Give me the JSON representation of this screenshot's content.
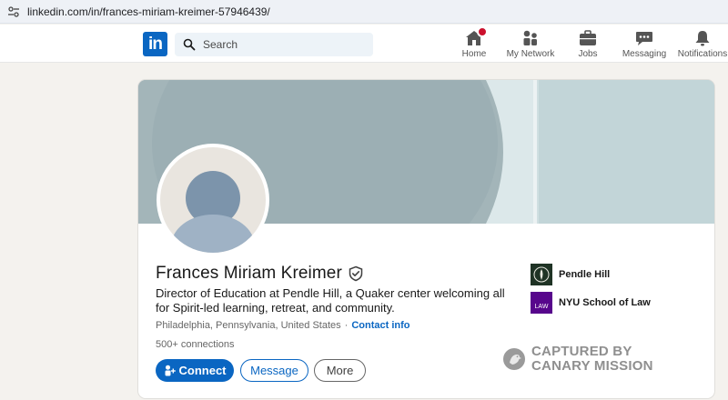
{
  "browser": {
    "url": "linkedin.com/in/frances-miriam-kreimer-57946439/"
  },
  "nav": {
    "search_placeholder": "Search",
    "items": [
      {
        "label": "Home",
        "icon": "home-icon",
        "badge": true
      },
      {
        "label": "My Network",
        "icon": "network-icon"
      },
      {
        "label": "Jobs",
        "icon": "briefcase-icon"
      },
      {
        "label": "Messaging",
        "icon": "messaging-icon"
      },
      {
        "label": "Notifications",
        "icon": "bell-icon"
      }
    ]
  },
  "profile": {
    "name": "Frances Miriam Kreimer",
    "headline": "Director of Education at Pendle Hill, a Quaker center welcoming all for Spirit-led learning, retreat, and community.",
    "location": "Philadelphia, Pennsylvania, United States",
    "separator": "·",
    "contact_info": "Contact info",
    "connections": "500+ connections",
    "buttons": {
      "connect": "Connect",
      "message": "Message",
      "more": "More"
    },
    "orgs": [
      {
        "name": "Pendle Hill"
      },
      {
        "name": "NYU School of Law",
        "logo_text": "LAW"
      }
    ]
  },
  "watermark": {
    "line1": "CAPTURED BY",
    "line2": "CANARY MISSION"
  },
  "colors": {
    "accent": "#0a66c2",
    "badge": "#cb112d",
    "nyu": "#57068c"
  }
}
